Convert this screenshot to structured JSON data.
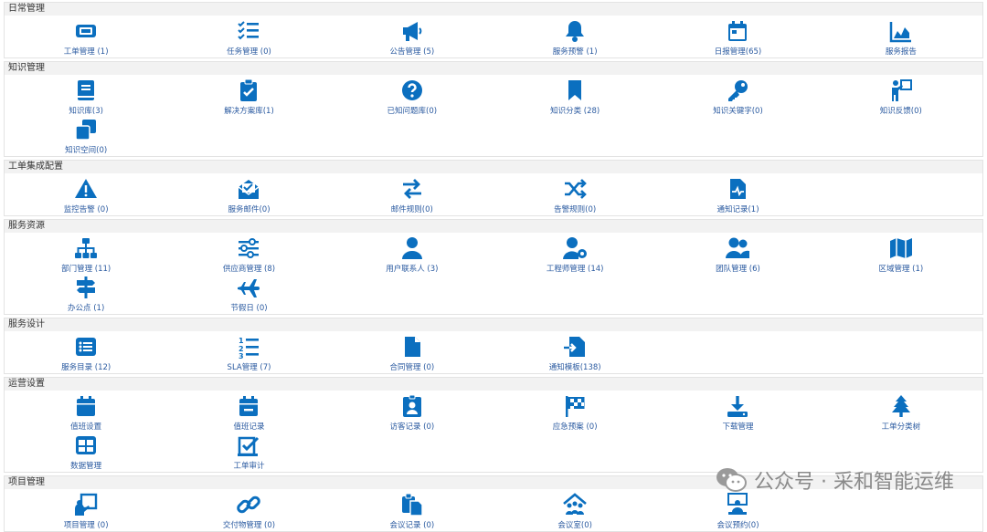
{
  "colors": {
    "icon": "#0b6fbf",
    "label": "#2a5aa0",
    "header_bg": "#f2f2f2"
  },
  "sections": [
    {
      "title": "日常管理",
      "items": [
        {
          "label": "工单管理 (1)",
          "icon": "ticket-icon"
        },
        {
          "label": "任务管理 (0)",
          "icon": "checklist-icon"
        },
        {
          "label": "公告管理 (5)",
          "icon": "megaphone-icon"
        },
        {
          "label": "服务预警 (1)",
          "icon": "bell-icon"
        },
        {
          "label": "日报管理(65)",
          "icon": "calendar-icon"
        },
        {
          "label": "服务报告",
          "icon": "area-chart-icon"
        }
      ]
    },
    {
      "title": "知识管理",
      "items": [
        {
          "label": "知识库(3)",
          "icon": "book-icon"
        },
        {
          "label": "解决方案库(1)",
          "icon": "clipboard-check-icon"
        },
        {
          "label": "已知问题库(0)",
          "icon": "question-icon"
        },
        {
          "label": "知识分类 (28)",
          "icon": "bookmark-icon"
        },
        {
          "label": "知识关键字(0)",
          "icon": "key-icon"
        },
        {
          "label": "知识反馈(0)",
          "icon": "presenter-icon"
        },
        {
          "label": "知识空间(0)",
          "icon": "clone-icon"
        }
      ]
    },
    {
      "title": "工单集成配置",
      "items": [
        {
          "label": "监控告警 (0)",
          "icon": "warning-icon"
        },
        {
          "label": "服务邮件(0)",
          "icon": "envelope-open-icon"
        },
        {
          "label": "邮件规则(0)",
          "icon": "exchange-icon"
        },
        {
          "label": "告警规则(0)",
          "icon": "shuffle-icon"
        },
        {
          "label": "通知记录(1)",
          "icon": "file-pulse-icon"
        }
      ]
    },
    {
      "title": "服务资源",
      "items": [
        {
          "label": "部门管理 (11)",
          "icon": "sitemap-icon"
        },
        {
          "label": "供应商管理 (8)",
          "icon": "sliders-icon"
        },
        {
          "label": "用户联系人 (3)",
          "icon": "user-icon"
        },
        {
          "label": "工程师管理 (14)",
          "icon": "user-gear-icon"
        },
        {
          "label": "团队管理 (6)",
          "icon": "users-icon"
        },
        {
          "label": "区域管理 (1)",
          "icon": "map-icon"
        },
        {
          "label": "办公点 (1)",
          "icon": "signpost-icon"
        },
        {
          "label": "节假日 (0)",
          "icon": "plane-icon"
        }
      ]
    },
    {
      "title": "服务设计",
      "items": [
        {
          "label": "服务目录 (12)",
          "icon": "list-icon"
        },
        {
          "label": "SLA管理 (7)",
          "icon": "list-ol-icon"
        },
        {
          "label": "合同管理 (0)",
          "icon": "file-icon"
        },
        {
          "label": "通知模板(138)",
          "icon": "file-import-icon"
        }
      ]
    },
    {
      "title": "运营设置",
      "items": [
        {
          "label": "值班设置",
          "icon": "calendar-full-icon"
        },
        {
          "label": "值班记录",
          "icon": "calendar-minus-icon"
        },
        {
          "label": "访客记录 (0)",
          "icon": "id-badge-icon"
        },
        {
          "label": "应急预案 (0)",
          "icon": "flag-checkered-icon"
        },
        {
          "label": "下载管理",
          "icon": "download-icon"
        },
        {
          "label": "工单分类树",
          "icon": "tree-icon"
        },
        {
          "label": "数据管理",
          "icon": "table-icon"
        },
        {
          "label": "工单审计",
          "icon": "square-check-icon"
        }
      ]
    },
    {
      "title": "项目管理",
      "items": [
        {
          "label": "项目管理 (0)",
          "icon": "chalkboard-icon"
        },
        {
          "label": "交付物管理 (0)",
          "icon": "link-icon"
        },
        {
          "label": "会议记录 (0)",
          "icon": "paste-icon"
        },
        {
          "label": "会议室(0)",
          "icon": "house-people-icon"
        },
        {
          "label": "会议预约(0)",
          "icon": "person-chalkboard-icon"
        }
      ]
    }
  ],
  "watermark": {
    "text": "公众号 · 采和智能运维",
    "icon": "wechat-icon"
  }
}
